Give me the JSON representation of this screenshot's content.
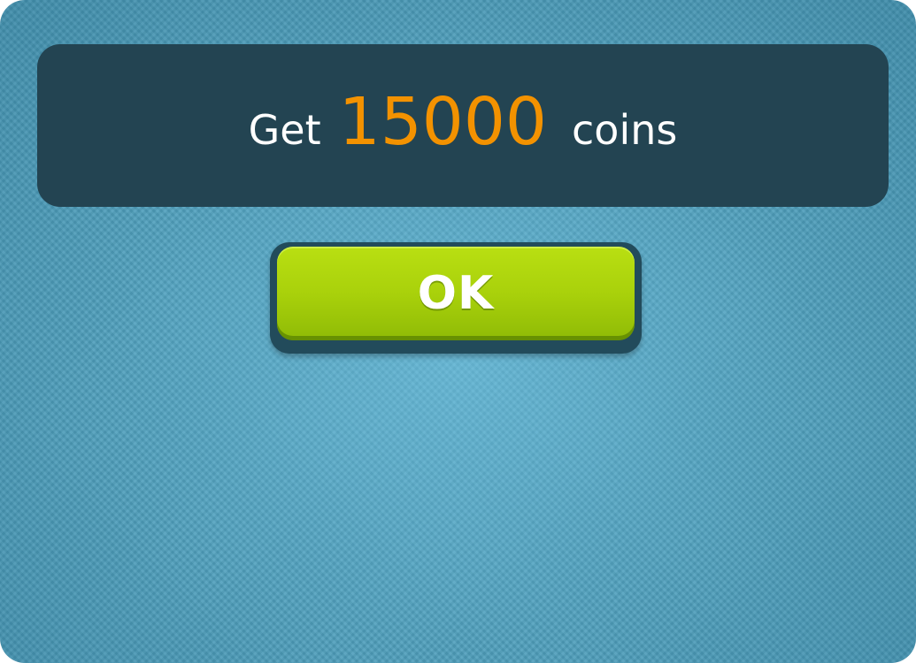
{
  "reward": {
    "prefix": "Get",
    "amount": "15000",
    "suffix": "coins"
  },
  "dialog": {
    "ok_label": "OK"
  },
  "colors": {
    "amount": "#f39200",
    "banner_bg": "#234452",
    "panel_bg": "#4f9fbc",
    "button_green": "#a9d10b"
  }
}
